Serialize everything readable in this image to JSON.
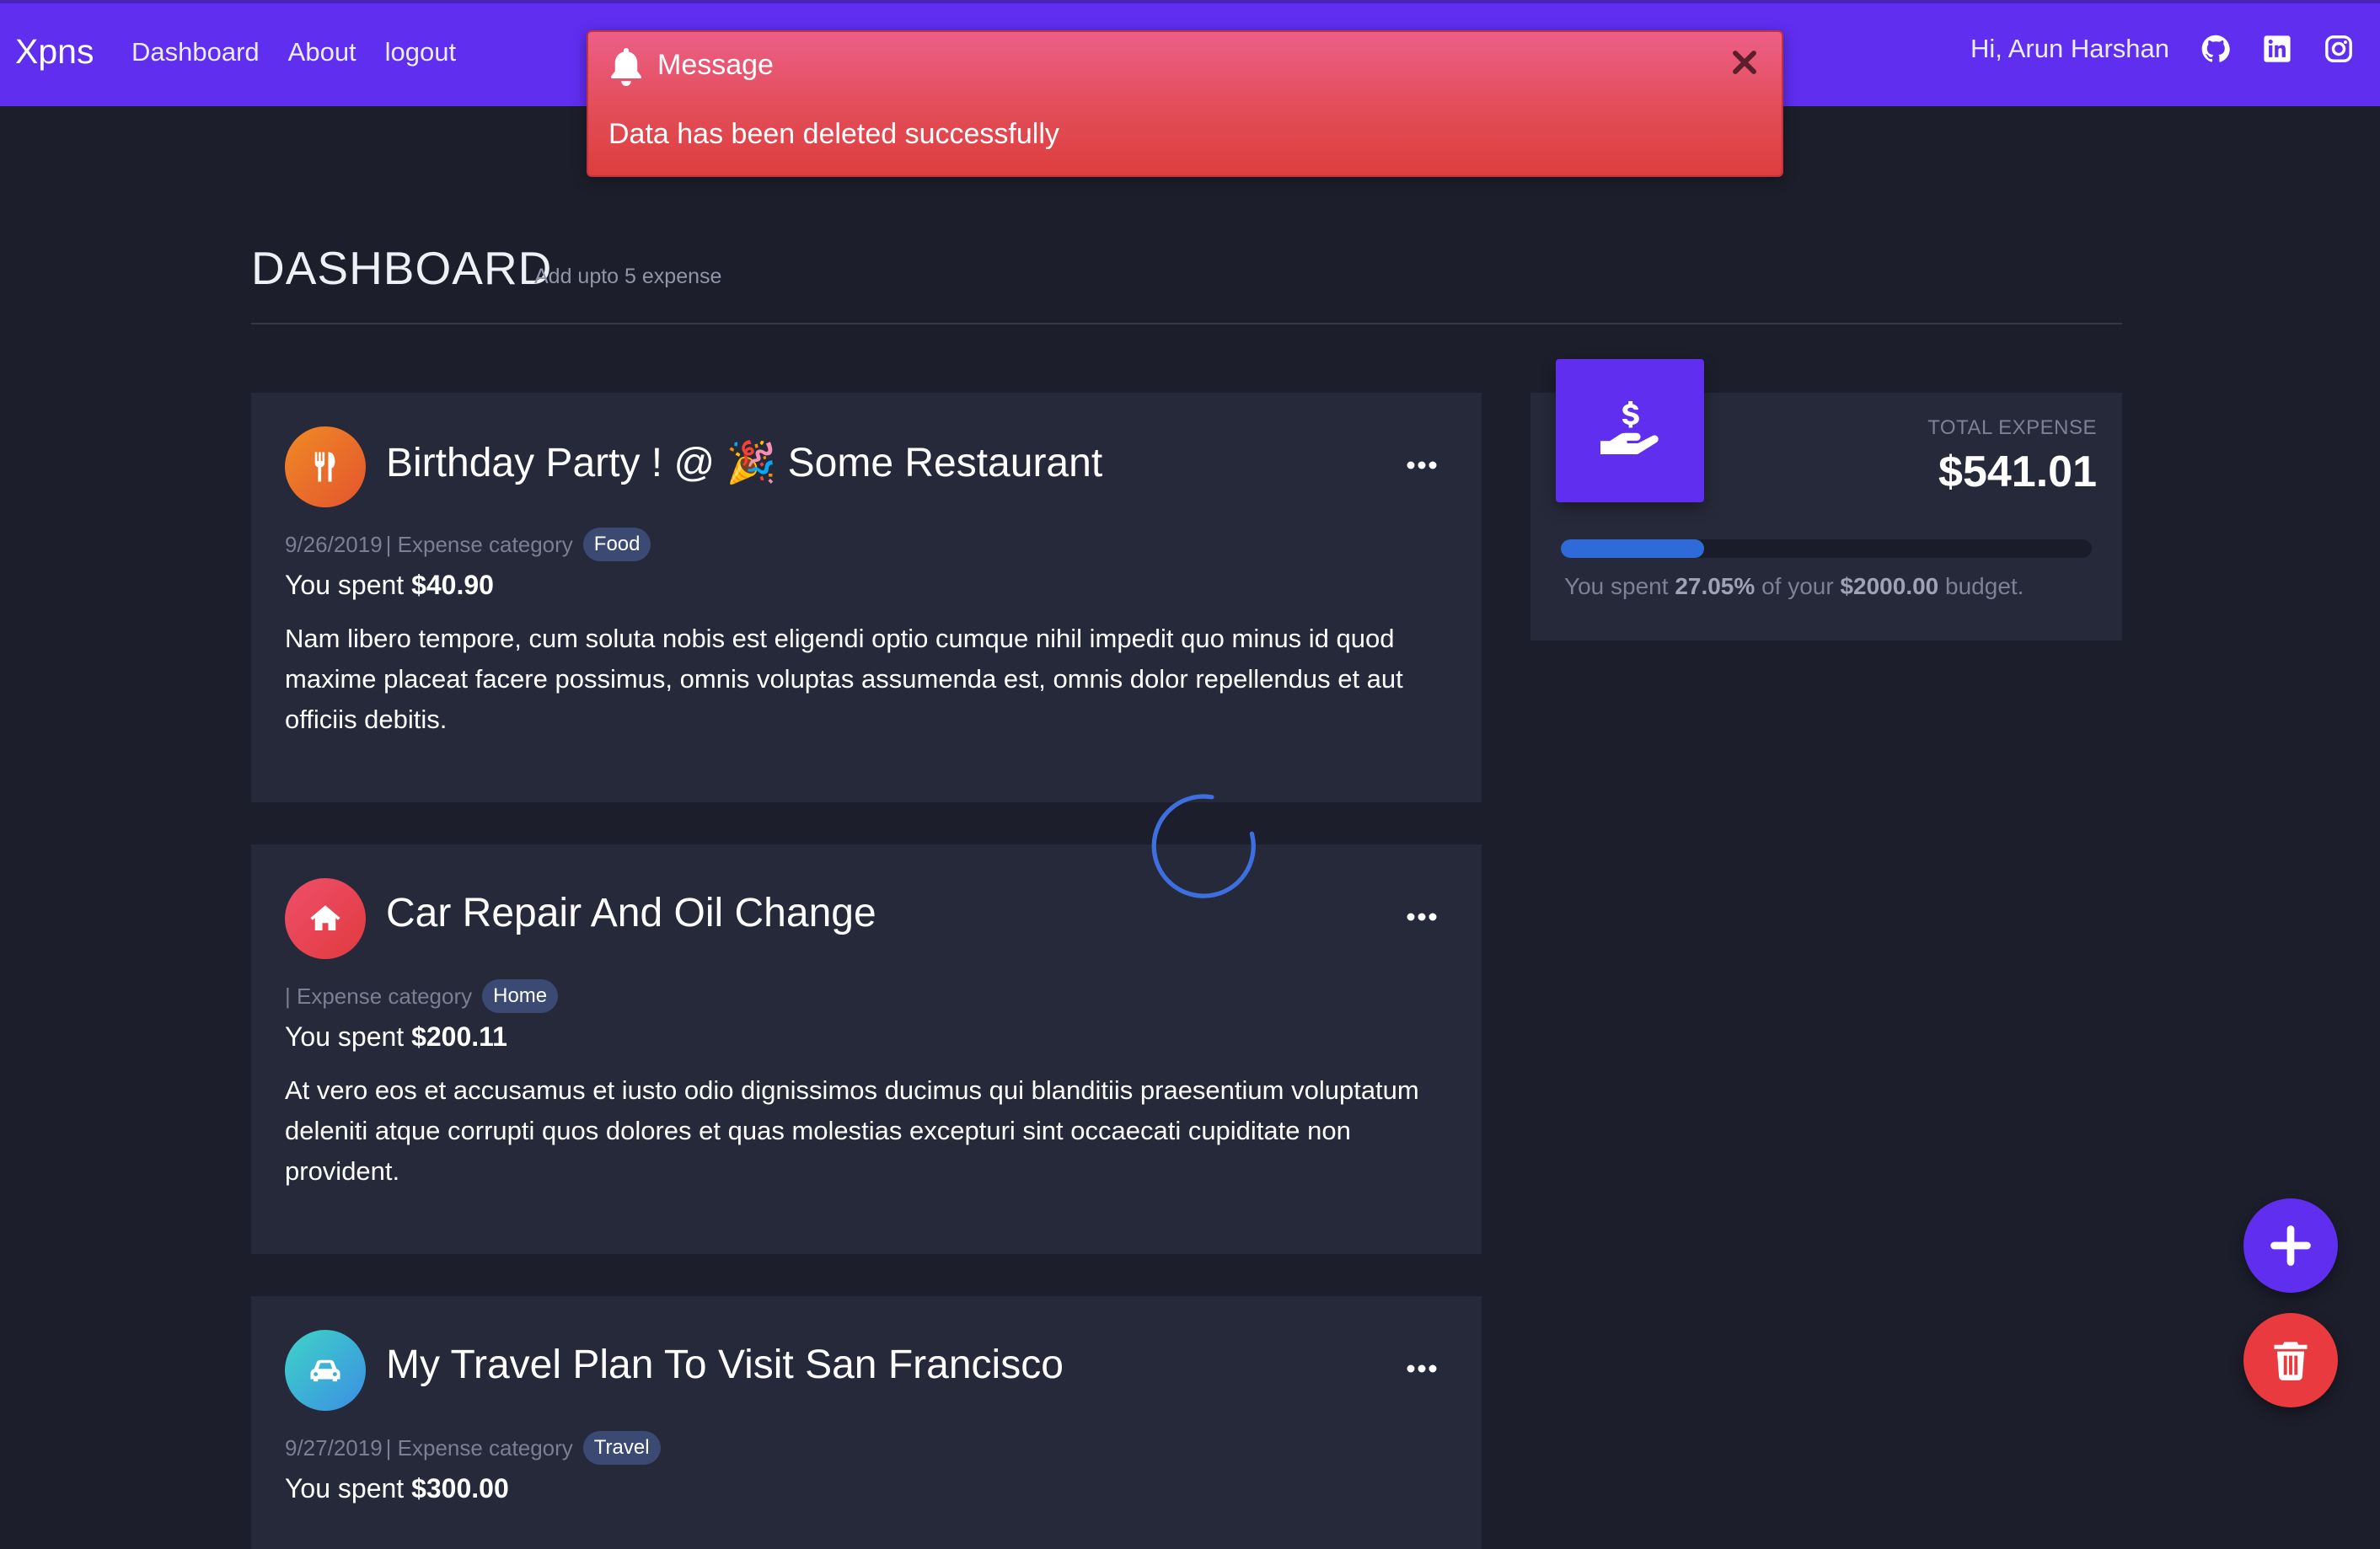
{
  "navbar": {
    "brand": "Xpns",
    "links": [
      "Dashboard",
      "About",
      "logout"
    ],
    "greeting": "Hi, Arun Harshan",
    "social_icons": [
      "github-icon",
      "linkedin-icon",
      "instagram-icon"
    ],
    "background_color": "#5f2eef"
  },
  "toast": {
    "title": "Message",
    "body": "Data has been deleted successfully",
    "color": "#e24b55"
  },
  "header": {
    "title": "DASHBOARD",
    "subtitle": "Add upto 5 expense"
  },
  "expenses": [
    {
      "title": "Birthday Party ! @ 🎉 Some Restaurant",
      "date": "9/26/2019",
      "category_label": "| Expense category",
      "category": "Food",
      "icon": "utensils-icon",
      "spent_prefix": "You spent",
      "amount": "$40.90",
      "description": "Nam libero tempore, cum soluta nobis est eligendi optio cumque nihil impedit quo minus id quod maxime placeat facere possimus, omnis voluptas assumenda est, omnis dolor repellendus et aut officiis debitis."
    },
    {
      "title": "Car Repair And Oil Change",
      "date": "",
      "category_label": "| Expense category",
      "category": "Home",
      "icon": "home-icon",
      "spent_prefix": "You spent",
      "amount": "$200.11",
      "description": "At vero eos et accusamus et iusto odio dignissimos ducimus qui blanditiis praesentium voluptatum deleniti atque corrupti quos dolores et quas molestias excepturi sint occaecati cupiditate non provident."
    },
    {
      "title": "My Travel Plan To Visit San Francisco",
      "date": "9/27/2019",
      "category_label": "| Expense category",
      "category": "Travel",
      "icon": "car-icon",
      "spent_prefix": "You spent",
      "amount": "$300.00",
      "description": ""
    }
  ],
  "total": {
    "label": "TOTAL EXPENSE",
    "amount": "$541.01",
    "icon": "hand-dollar-icon",
    "progress_percent": 27.05,
    "budget_prefix": "You spent",
    "percent_text": "27.05%",
    "budget_middle": "of your",
    "budget_amount": "$2000.00",
    "budget_suffix": "budget."
  },
  "fabs": {
    "add_icon": "plus-icon",
    "delete_icon": "trash-icon"
  }
}
